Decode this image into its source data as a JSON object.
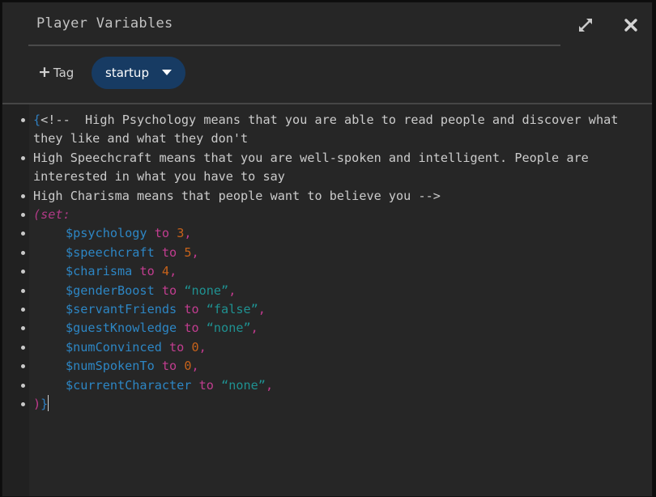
{
  "dialog": {
    "title": "Player Variables",
    "maximize_icon": "maximize-arrows-icon",
    "close_icon": "close-x-icon"
  },
  "toolbar": {
    "add_tag_label": "Tag",
    "add_tag_icon": "plus-icon",
    "tag": {
      "label": "startup",
      "color": "#173b63",
      "dropdown_icon": "caret-down-icon"
    }
  },
  "editor": {
    "comment": [
      "High Psychology means that you are able to read people and discover what they like and what they don't",
      "High Speechcraft means that you are well-spoken and intelligent. People are interested in what you have to say",
      "High Charisma means that people want to believe you -->"
    ],
    "comment_open": "{<!--  ",
    "macro": "(set:",
    "keyword": "to",
    "assignments": [
      {
        "var": "$psychology",
        "value": "3",
        "type": "number"
      },
      {
        "var": "$speechcraft",
        "value": "5",
        "type": "number"
      },
      {
        "var": "$charisma",
        "value": "4",
        "type": "number"
      },
      {
        "var": "$genderBoost",
        "value": "“none”",
        "type": "string"
      },
      {
        "var": "$servantFriends",
        "value": "“false”",
        "type": "string"
      },
      {
        "var": "$guestKnowledge",
        "value": "“none”",
        "type": "string"
      },
      {
        "var": "$numConvinced",
        "value": "0",
        "type": "number"
      },
      {
        "var": "$numSpokenTo",
        "value": "0",
        "type": "number"
      },
      {
        "var": "$currentCharacter",
        "value": "“none”",
        "type": "string"
      }
    ],
    "close_paren": ")",
    "close_brace": "}",
    "colors": {
      "variable": "#2d86c4",
      "keyword": "#c13d8f",
      "number": "#c7621a",
      "string": "#1f9191",
      "text": "#cbcbcb"
    }
  }
}
